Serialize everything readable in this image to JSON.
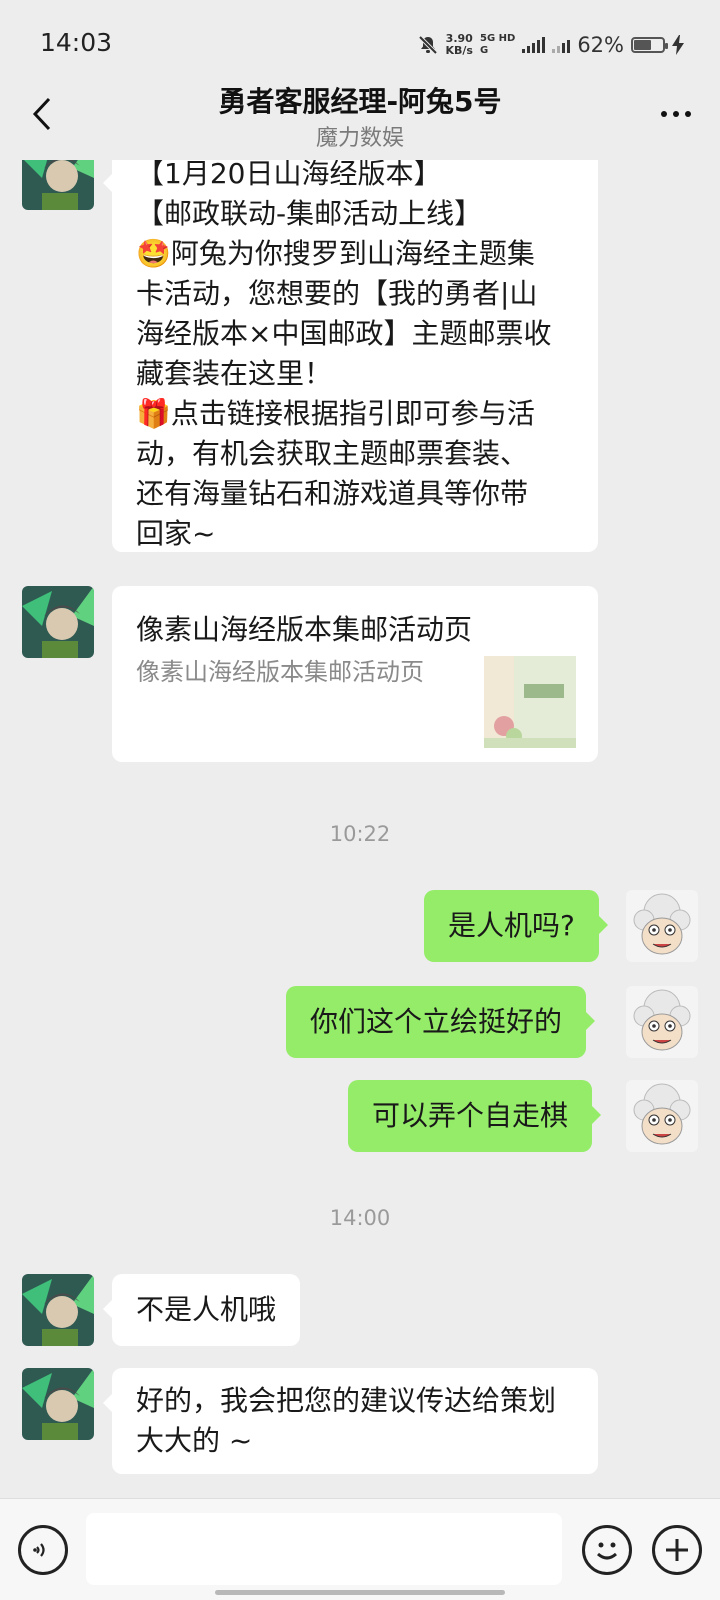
{
  "status_bar": {
    "time": "14:03",
    "net_speed_value": "3.90",
    "net_speed_unit": "KB/s",
    "net_tag_top": "5G HD",
    "net_tag_bottom": "G",
    "battery": "62%",
    "battery_level": 0.62,
    "icons": [
      "mute-bell-icon",
      "signal-icon",
      "battery-icon",
      "charging-icon"
    ]
  },
  "header": {
    "title": "勇者客服经理-阿兔5号",
    "subtitle": "魔力数娱"
  },
  "messages": {
    "m1": {
      "lines": [
        "【1月20日山海经版本】",
        "【邮政联动-集邮活动上线】",
        "🤩阿兔为你搜罗到山海经主题集",
        "卡活动，您想要的【我的勇者|山",
        "海经版本×中国邮政】主题邮票收",
        "藏套装在这里！",
        "🎁点击链接根据指引即可参与活",
        "动，有机会获取主题邮票套装、",
        "还有海量钻石和游戏道具等你带",
        "回家~"
      ]
    },
    "link_card": {
      "title": "像素山海经版本集邮活动页",
      "description": "像素山海经版本集邮活动页"
    },
    "time1": "10:22",
    "m2": "是人机吗?",
    "m3": "你们这个立绘挺好的",
    "m4": "可以弄个自走棋",
    "time2": "14:00",
    "m5": "不是人机哦",
    "m6": {
      "lines": [
        "好的，我会把您的建议传达给策划",
        "大大的 ~"
      ]
    }
  },
  "input": {
    "placeholder": ""
  }
}
